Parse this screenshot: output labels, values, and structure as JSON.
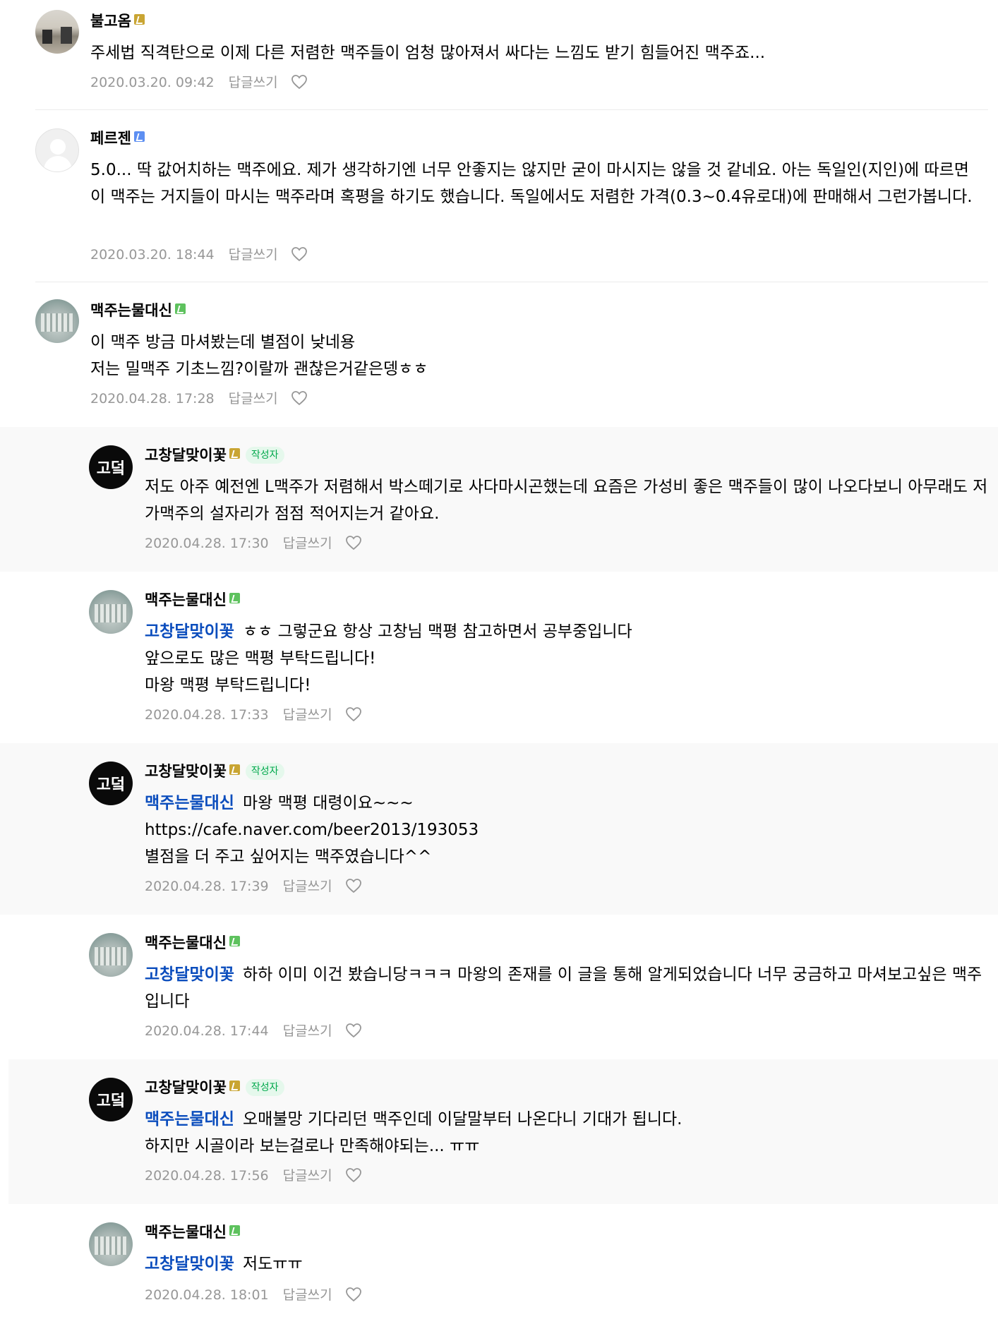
{
  "comments": [
    {
      "nickname": "불고옴",
      "is_writer": false,
      "badge": "gold",
      "mention": "",
      "text": "주세법 직격탄으로 이제 다른 저렴한 맥주들이 엄청 많아져서 싸다는 느낌도 받기 힘들어진 맥주죠...",
      "date": "2020.03.20. 09:42",
      "reply_label": "답글쓰기"
    },
    {
      "nickname": "페르젠",
      "is_writer": false,
      "badge": "blue",
      "mention": "",
      "text": "5.0... 딱 값어치하는 맥주에요. 제가 생각하기엔 너무 안좋지는 않지만 굳이 마시지는 않을 것 같네요. 아는 독일인(지인)에 따르면 이 맥주는 거지들이 마시는 맥주라며 혹평을 하기도 했습니다. 독일에서도 저렴한 가격(0.3~0.4유로대)에 판매해서 그런가봅니다.",
      "date": "2020.03.20. 18:44",
      "reply_label": "답글쓰기"
    },
    {
      "nickname": "맥주는물대신",
      "is_writer": false,
      "badge": "green",
      "mention": "",
      "text": "이 맥주 방금 마셔봤는데 별점이 낮네용\n저는 밀맥주 기초느낌?이랄까 괜찮은거같은뎅ㅎㅎ",
      "date": "2020.04.28. 17:28",
      "reply_label": "답글쓰기"
    },
    {
      "nickname": "고창달맞이꽃",
      "is_writer": true,
      "writer_label": "작성자",
      "badge": "gold",
      "mention": "",
      "text": "저도 아주 예전엔 L맥주가 저렴해서 박스떼기로 사다마시곤했는데 요즘은 가성비 좋은 맥주들이 많이 나오다보니 아무래도 저가맥주의 설자리가 점점 적어지는거 같아요.",
      "date": "2020.04.28. 17:30",
      "reply_label": "답글쓰기"
    },
    {
      "nickname": "맥주는물대신",
      "is_writer": false,
      "badge": "green",
      "mention": "고창달맞이꽃",
      "text": "ㅎㅎ 그렇군요 항상 고창님 맥평 참고하면서 공부중입니다\n앞으로도 많은 맥평 부탁드립니다!\n마왕 맥평 부탁드립니다!",
      "date": "2020.04.28. 17:33",
      "reply_label": "답글쓰기"
    },
    {
      "nickname": "고창달맞이꽃",
      "is_writer": true,
      "writer_label": "작성자",
      "badge": "gold",
      "mention": "맥주는물대신",
      "text": "마왕 맥평 대령이요~~~\nhttps://cafe.naver.com/beer2013/193053\n별점을 더 주고 싶어지는 맥주였습니다^^",
      "date": "2020.04.28. 17:39",
      "reply_label": "답글쓰기"
    },
    {
      "nickname": "맥주는물대신",
      "is_writer": false,
      "badge": "green",
      "mention": "고창달맞이꽃",
      "text": "하하 이미 이건 봤습니당ㅋㅋㅋ 마왕의 존재를 이 글을 통해 알게되었습니다 너무 궁금하고 마셔보고싶은 맥주입니다",
      "date": "2020.04.28. 17:44",
      "reply_label": "답글쓰기"
    },
    {
      "nickname": "고창달맞이꽃",
      "is_writer": true,
      "writer_label": "작성자",
      "badge": "gold",
      "mention": "맥주는물대신",
      "text": "오매불망 기다리던 맥주인데 이달말부터 나온다니 기대가 됩니다.\n하지만 시골이라 보는걸로나 만족해야되는... ㅠㅠ",
      "date": "2020.04.28. 17:56",
      "reply_label": "답글쓰기"
    },
    {
      "nickname": "맥주는물대신",
      "is_writer": false,
      "badge": "green",
      "mention": "고창달맞이꽃",
      "text": "저도ㅠㅠ",
      "date": "2020.04.28. 18:01",
      "reply_label": "답글쓰기"
    }
  ],
  "logo_text": "고덬",
  "colors": {
    "mention": "#0b4dbd",
    "meta": "#979797",
    "writer_tag_bg": "#e5f8ec",
    "writer_tag_text": "#03a94d",
    "reply_bg": "#f9f9f9"
  }
}
